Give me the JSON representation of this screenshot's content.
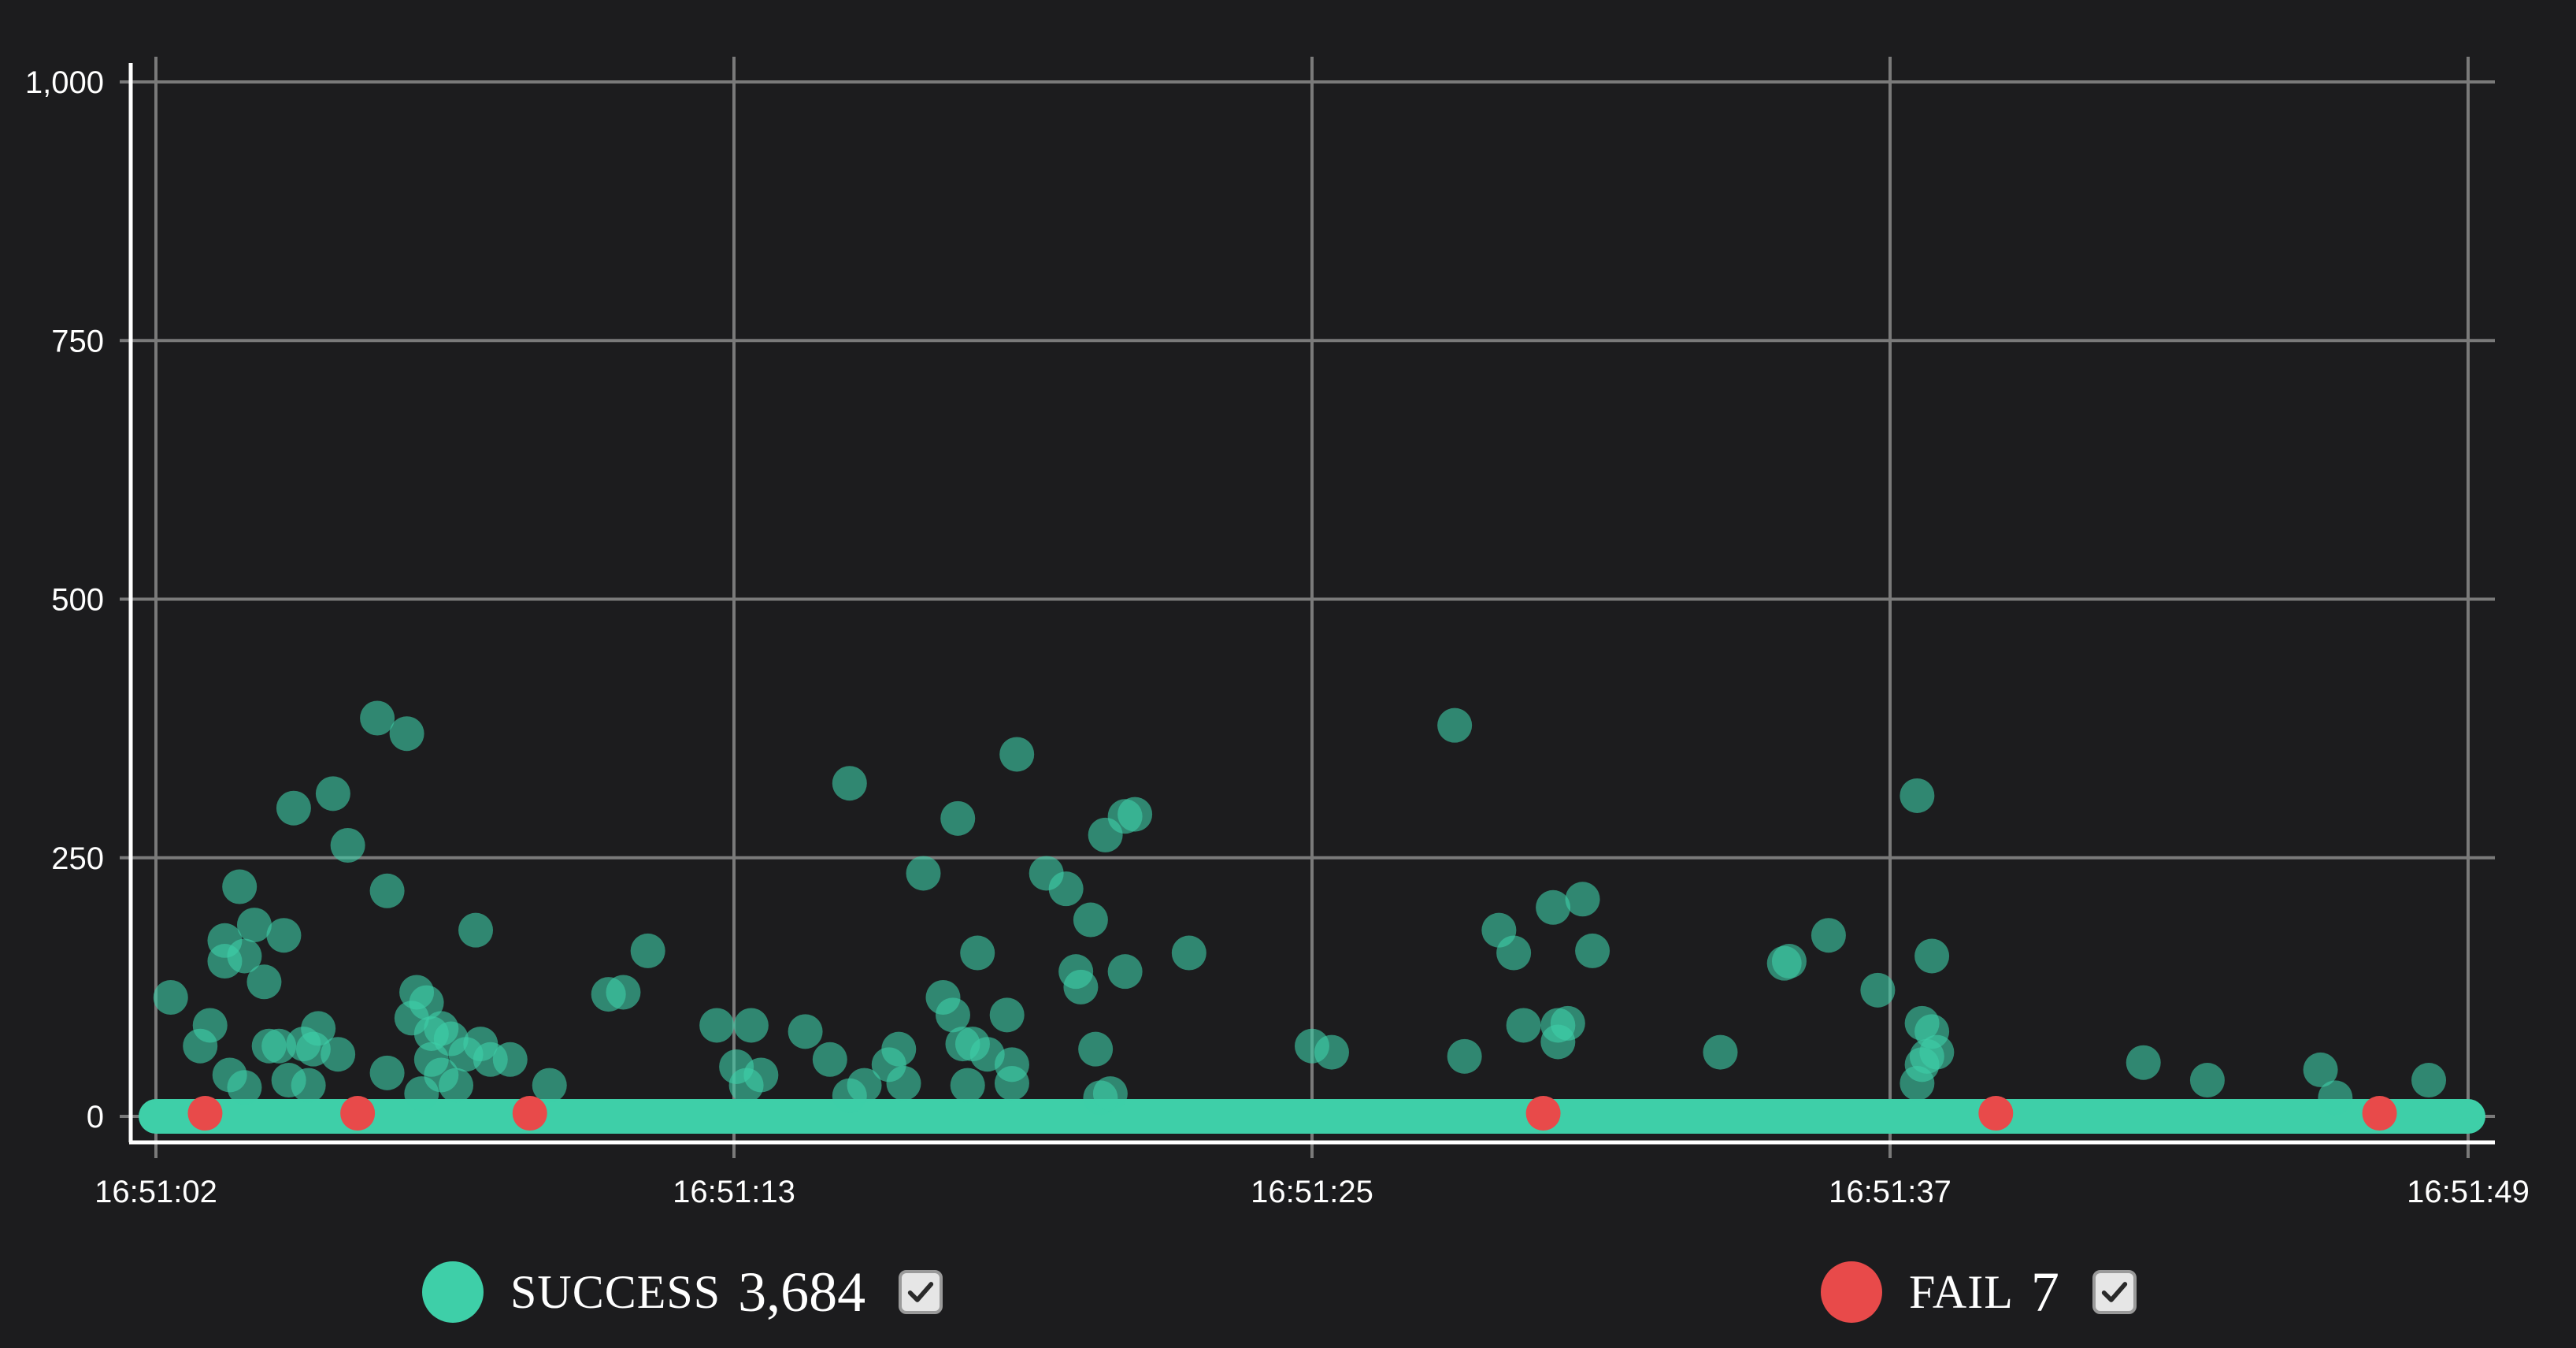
{
  "chart_data": {
    "type": "scatter",
    "title": "",
    "xlabel": "",
    "ylabel": "",
    "x_unit": "seconds elapsed",
    "x_range": [
      0,
      47
    ],
    "ylim": [
      0,
      1000
    ],
    "y_ticks": [
      0,
      250,
      500,
      750,
      1000
    ],
    "y_tick_labels": [
      "0",
      "250",
      "500",
      "750",
      "1,000"
    ],
    "x_ticks": [
      0,
      11.75,
      23.5,
      35.25,
      47
    ],
    "x_tick_labels": [
      "16:51:02",
      "16:51:13",
      "16:51:25",
      "16:51:37",
      "16:51:49"
    ],
    "grid": true,
    "legend_position": "bottom",
    "series": [
      {
        "name": "SUCCESS",
        "count": "3,684",
        "color": "#3ecfa8",
        "marker_opacity": 0.6,
        "baseline_band": [
          0,
          47,
          0
        ],
        "points": [
          [
            0.3,
            115
          ],
          [
            0.9,
            68
          ],
          [
            1.1,
            88
          ],
          [
            1.4,
            170
          ],
          [
            1.4,
            150
          ],
          [
            1.5,
            40
          ],
          [
            1.7,
            222
          ],
          [
            1.8,
            155
          ],
          [
            1.8,
            28
          ],
          [
            2.0,
            185
          ],
          [
            2.2,
            130
          ],
          [
            2.3,
            68
          ],
          [
            2.5,
            68
          ],
          [
            2.6,
            175
          ],
          [
            2.7,
            35
          ],
          [
            2.8,
            298
          ],
          [
            3.0,
            70
          ],
          [
            3.1,
            30
          ],
          [
            3.2,
            65
          ],
          [
            3.3,
            85
          ],
          [
            3.6,
            312
          ],
          [
            3.7,
            60
          ],
          [
            3.9,
            262
          ],
          [
            4.5,
            385
          ],
          [
            4.7,
            218
          ],
          [
            4.7,
            42
          ],
          [
            5.1,
            370
          ],
          [
            5.2,
            95
          ],
          [
            5.3,
            120
          ],
          [
            5.4,
            22
          ],
          [
            5.5,
            110
          ],
          [
            5.6,
            55
          ],
          [
            5.6,
            80
          ],
          [
            5.8,
            85
          ],
          [
            5.8,
            40
          ],
          [
            6.0,
            75
          ],
          [
            6.1,
            30
          ],
          [
            6.3,
            60
          ],
          [
            6.5,
            180
          ],
          [
            6.6,
            70
          ],
          [
            6.8,
            55
          ],
          [
            7.2,
            55
          ],
          [
            8.0,
            30
          ],
          [
            9.2,
            118
          ],
          [
            9.5,
            120
          ],
          [
            10.0,
            160
          ],
          [
            11.4,
            88
          ],
          [
            11.8,
            48
          ],
          [
            12.0,
            30
          ],
          [
            12.1,
            88
          ],
          [
            12.3,
            40
          ],
          [
            13.2,
            82
          ],
          [
            13.7,
            55
          ],
          [
            14.1,
            20
          ],
          [
            14.4,
            30
          ],
          [
            14.1,
            322
          ],
          [
            14.9,
            50
          ],
          [
            15.1,
            65
          ],
          [
            15.2,
            32
          ],
          [
            15.6,
            235
          ],
          [
            16.0,
            115
          ],
          [
            16.2,
            98
          ],
          [
            16.3,
            288
          ],
          [
            16.4,
            70
          ],
          [
            16.5,
            30
          ],
          [
            16.6,
            70
          ],
          [
            16.7,
            158
          ],
          [
            16.9,
            60
          ],
          [
            17.3,
            98
          ],
          [
            17.4,
            50
          ],
          [
            17.4,
            32
          ],
          [
            17.5,
            350
          ],
          [
            18.1,
            235
          ],
          [
            18.5,
            220
          ],
          [
            18.7,
            140
          ],
          [
            18.8,
            125
          ],
          [
            19.0,
            190
          ],
          [
            19.1,
            65
          ],
          [
            19.2,
            18
          ],
          [
            19.3,
            272
          ],
          [
            19.4,
            22
          ],
          [
            19.7,
            290
          ],
          [
            19.7,
            140
          ],
          [
            19.9,
            292
          ],
          [
            21.0,
            158
          ],
          [
            23.5,
            68
          ],
          [
            23.9,
            62
          ],
          [
            26.4,
            378
          ],
          [
            26.6,
            58
          ],
          [
            27.3,
            180
          ],
          [
            27.6,
            158
          ],
          [
            27.8,
            88
          ],
          [
            28.4,
            202
          ],
          [
            28.5,
            88
          ],
          [
            28.5,
            72
          ],
          [
            28.7,
            90
          ],
          [
            29.0,
            210
          ],
          [
            29.2,
            160
          ],
          [
            31.8,
            62
          ],
          [
            33.1,
            148
          ],
          [
            33.2,
            150
          ],
          [
            34.0,
            175
          ],
          [
            35.0,
            122
          ],
          [
            35.8,
            310
          ],
          [
            35.9,
            90
          ],
          [
            35.8,
            32
          ],
          [
            35.9,
            50
          ],
          [
            36.0,
            58
          ],
          [
            36.1,
            155
          ],
          [
            36.1,
            82
          ],
          [
            36.2,
            62
          ],
          [
            40.4,
            52
          ],
          [
            41.7,
            35
          ],
          [
            44.0,
            45
          ],
          [
            44.3,
            18
          ],
          [
            46.2,
            35
          ]
        ]
      },
      {
        "name": "FAIL",
        "count": "7",
        "color": "#e84a4a",
        "points": [
          [
            1.0,
            3
          ],
          [
            4.1,
            3
          ],
          [
            7.6,
            3
          ],
          [
            28.2,
            3
          ],
          [
            37.4,
            3
          ],
          [
            45.2,
            3
          ]
        ]
      }
    ]
  },
  "legend": {
    "items": [
      {
        "name": "SUCCESS",
        "count": "3,684",
        "color": "#3ecfa8",
        "checked": true
      },
      {
        "name": "FAIL",
        "count": "7",
        "color": "#e84a4a",
        "checked": true
      }
    ]
  }
}
